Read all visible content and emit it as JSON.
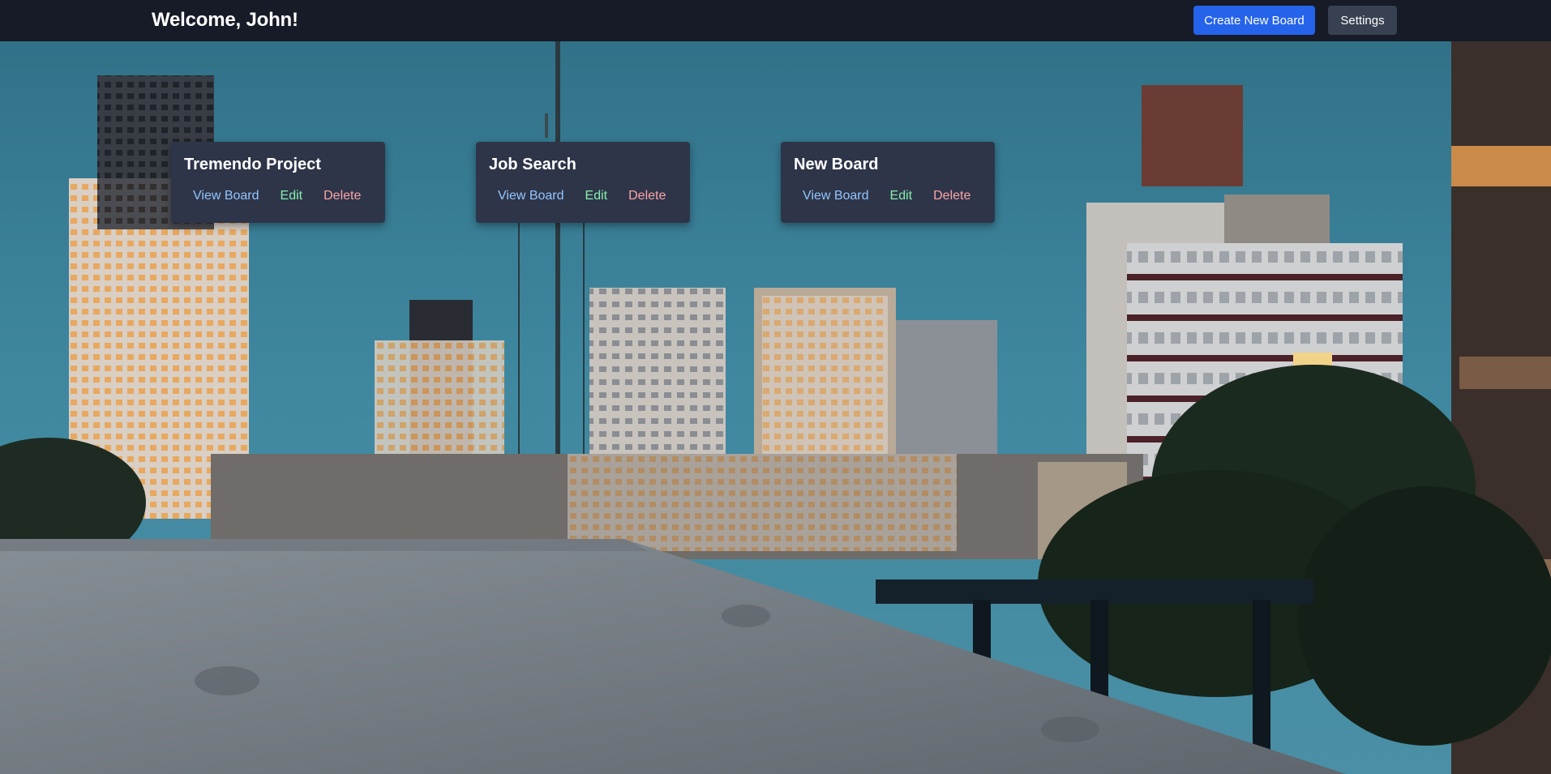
{
  "header": {
    "welcome": "Welcome, John!",
    "create_label": "Create New Board",
    "settings_label": "Settings"
  },
  "boards": [
    {
      "title": "Tremendo Project",
      "view_label": "View Board",
      "edit_label": "Edit",
      "delete_label": "Delete"
    },
    {
      "title": "Job Search",
      "view_label": "View Board",
      "edit_label": "Edit",
      "delete_label": "Delete"
    },
    {
      "title": "New Board",
      "view_label": "View Board",
      "edit_label": "Edit",
      "delete_label": "Delete"
    }
  ],
  "colors": {
    "header_bg": "#161b27",
    "primary_button": "#2563eb",
    "secondary_button": "#374151",
    "board_card": "#2e3549",
    "view_link": "#93c5fd",
    "edit_link": "#86efac",
    "delete_link": "#fca5a5"
  }
}
